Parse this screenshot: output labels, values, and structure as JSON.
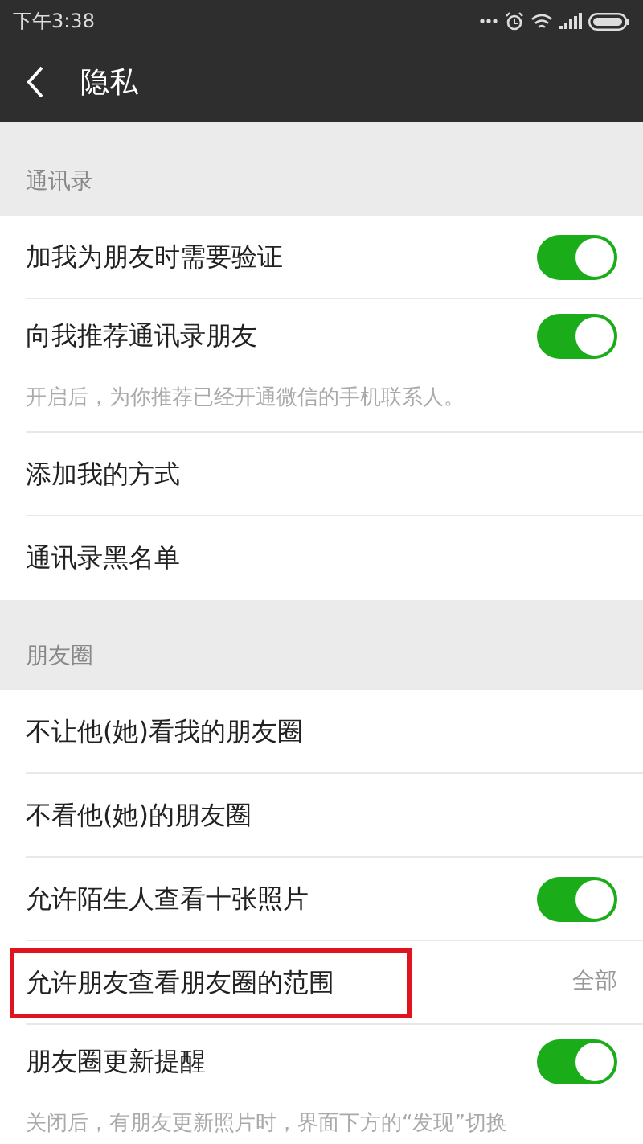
{
  "status_bar": {
    "time": "下午3:38"
  },
  "header": {
    "title": "隐私"
  },
  "sections": [
    {
      "title": "通讯录",
      "items": [
        {
          "kind": "toggle",
          "label": "加我为朋友时需要验证",
          "on": true,
          "highlighted": false
        },
        {
          "kind": "toggle",
          "label": "向我推荐通讯录朋友",
          "on": true,
          "highlighted": false
        },
        {
          "kind": "hint",
          "label": "开启后，为你推荐已经开通微信的手机联系人。"
        },
        {
          "kind": "link",
          "label": "添加我的方式",
          "highlighted": false
        },
        {
          "kind": "link",
          "label": "通讯录黑名单",
          "highlighted": false
        }
      ]
    },
    {
      "title": "朋友圈",
      "items": [
        {
          "kind": "link",
          "label": "不让他(她)看我的朋友圈",
          "highlighted": false
        },
        {
          "kind": "link",
          "label": "不看他(她)的朋友圈",
          "highlighted": false
        },
        {
          "kind": "toggle",
          "label": "允许陌生人查看十张照片",
          "on": true,
          "highlighted": false
        },
        {
          "kind": "value",
          "label": "允许朋友查看朋友圈的范围",
          "value": "全部",
          "highlighted": true
        },
        {
          "kind": "toggle",
          "label": "朋友圈更新提醒",
          "on": true,
          "highlighted": false
        },
        {
          "kind": "hint",
          "label": "关闭后，有朋友更新照片时，界面下方的“发现”切换"
        }
      ]
    }
  ]
}
